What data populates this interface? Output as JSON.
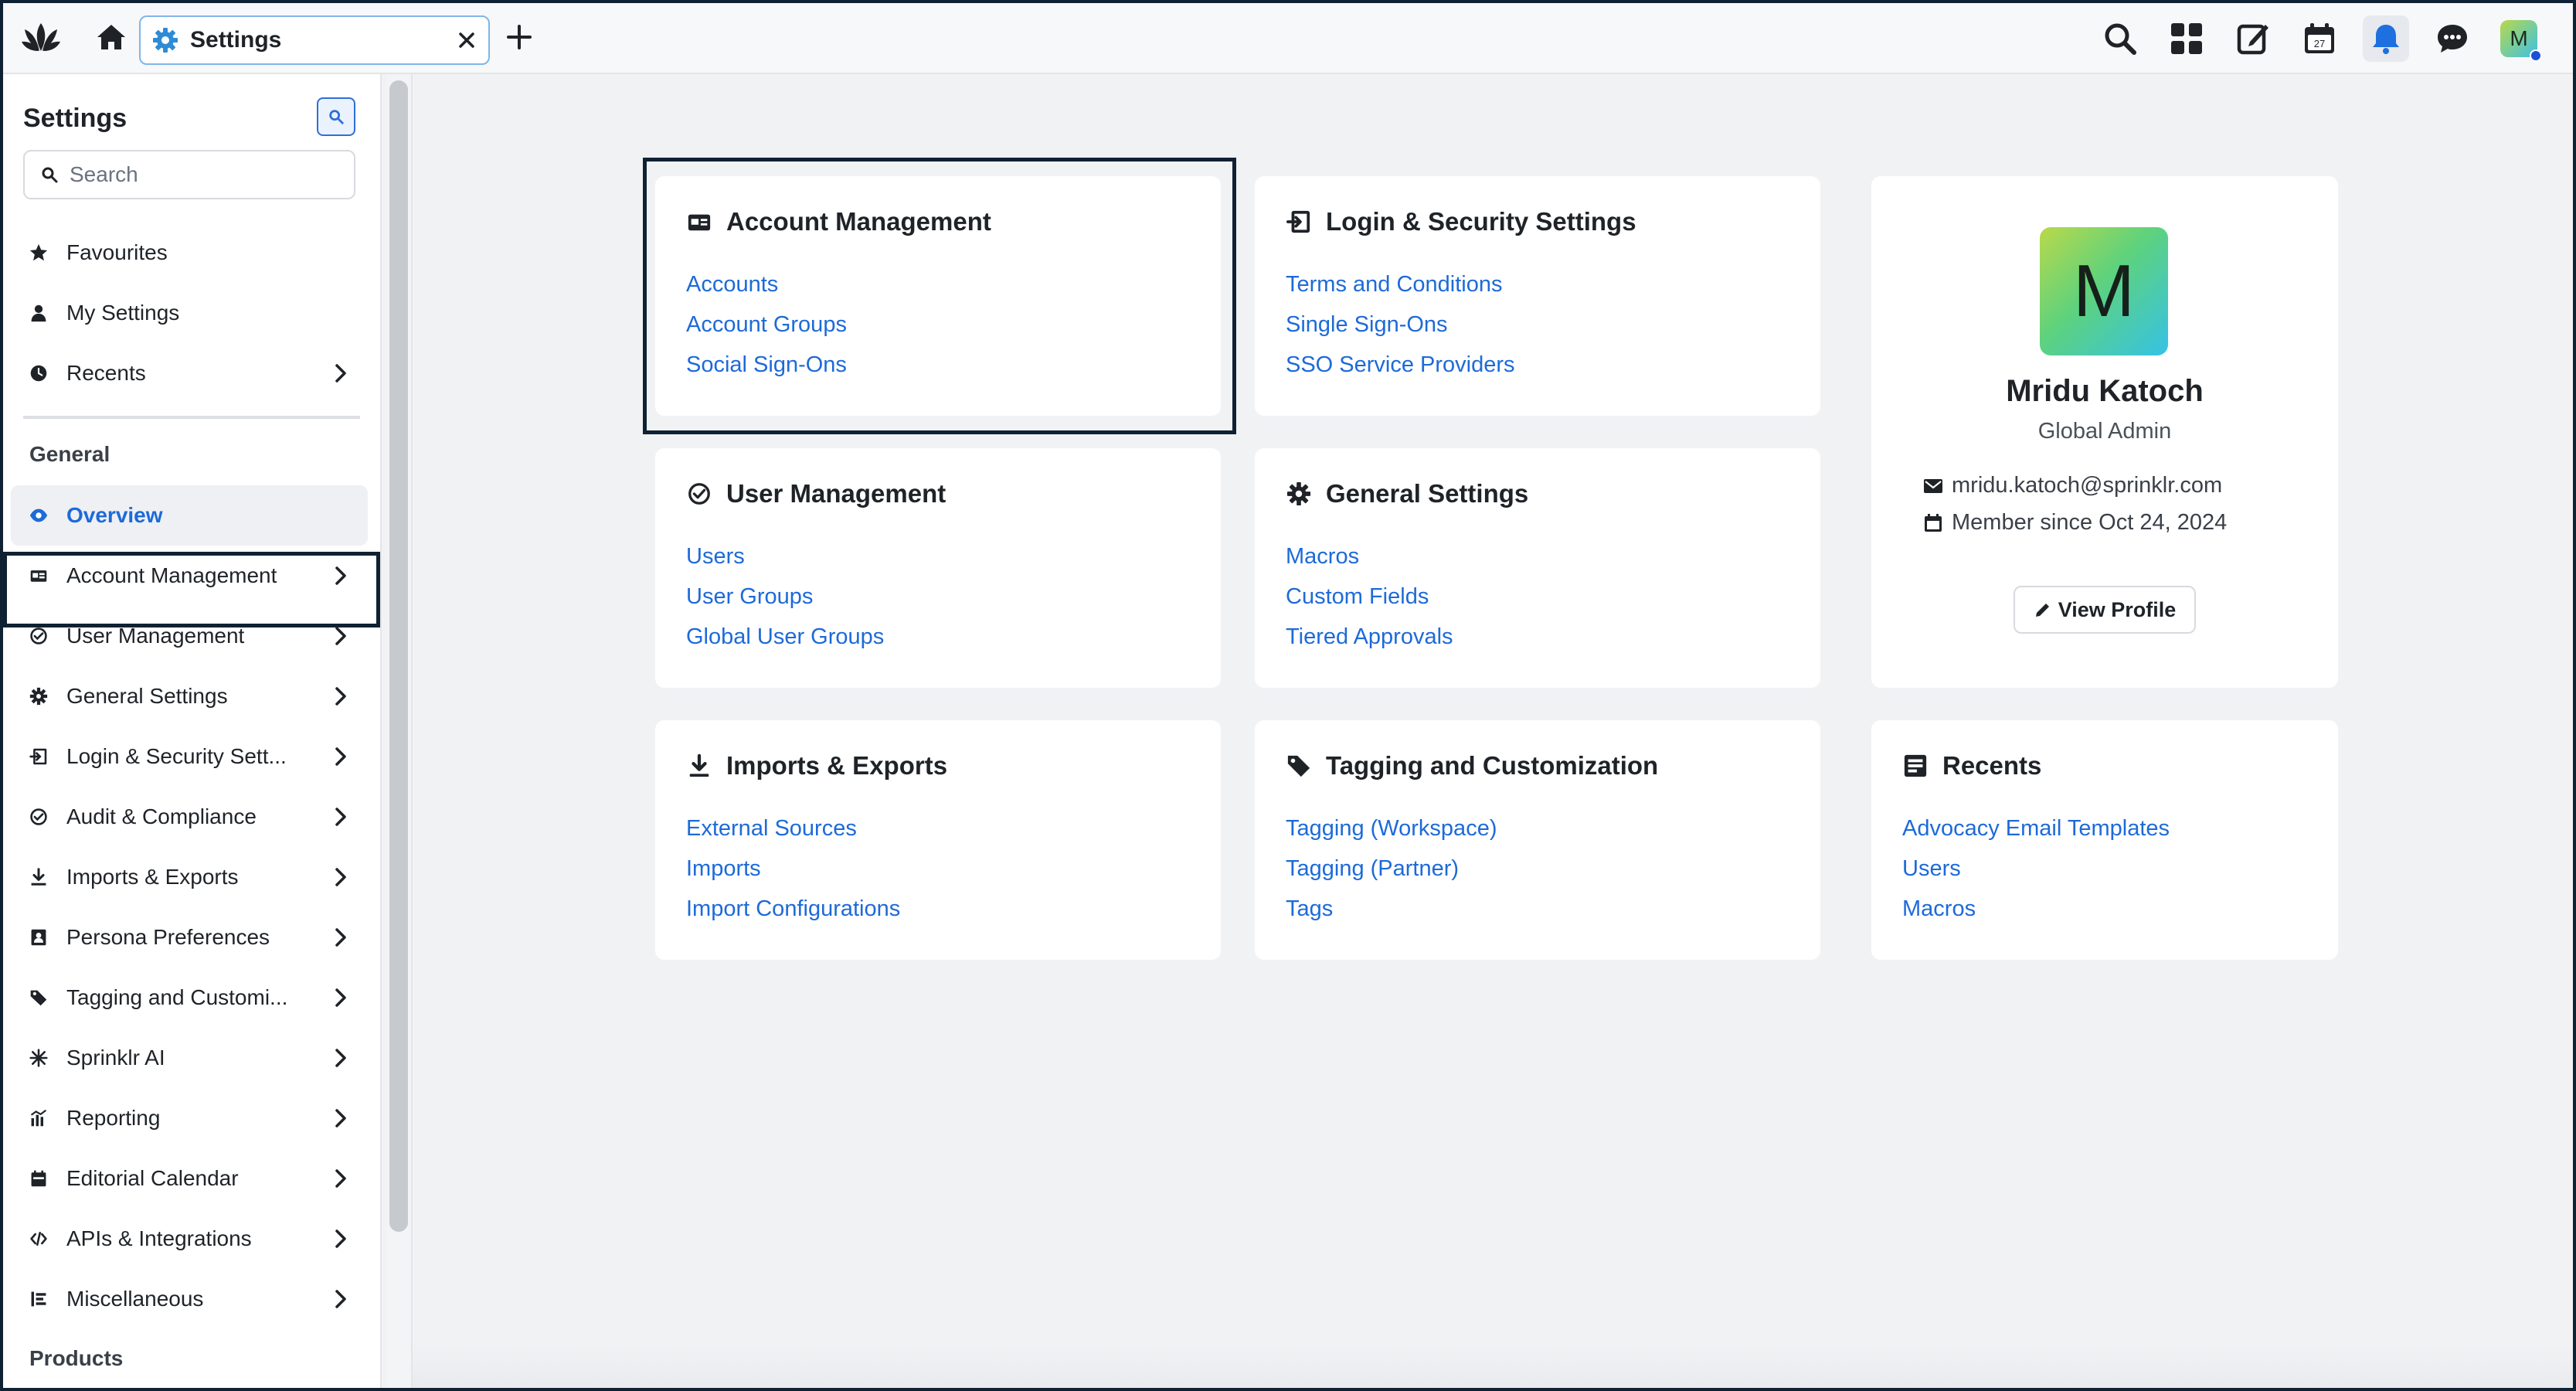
{
  "topbar": {
    "tab_label": "Settings",
    "avatar_initial": "M"
  },
  "sidebar": {
    "title": "Settings",
    "search_placeholder": "Search",
    "quick": [
      {
        "label": "Favourites",
        "icon": "star-icon"
      },
      {
        "label": "My Settings",
        "icon": "person-icon"
      },
      {
        "label": "Recents",
        "icon": "clock-icon"
      }
    ],
    "section_general": "General",
    "overview": "Overview",
    "items": [
      {
        "label": "Account Management",
        "icon": "account-card-icon"
      },
      {
        "label": "User Management",
        "icon": "check-circle-icon"
      },
      {
        "label": "General Settings",
        "icon": "gear-icon"
      },
      {
        "label": "Login & Security Sett...",
        "icon": "login-icon"
      },
      {
        "label": "Audit & Compliance",
        "icon": "audit-icon"
      },
      {
        "label": "Imports & Exports",
        "icon": "download-icon"
      },
      {
        "label": "Persona Preferences",
        "icon": "persona-icon"
      },
      {
        "label": "Tagging and Customi...",
        "icon": "tag-icon"
      },
      {
        "label": "Sprinklr AI",
        "icon": "ai-spark-icon"
      },
      {
        "label": "Reporting",
        "icon": "chart-icon"
      },
      {
        "label": "Editorial Calendar",
        "icon": "calendar-icon"
      },
      {
        "label": "APIs & Integrations",
        "icon": "code-icon"
      },
      {
        "label": "Miscellaneous",
        "icon": "list-icon"
      }
    ],
    "section_products": "Products"
  },
  "cards": {
    "account": {
      "title": "Account Management",
      "links": [
        "Accounts",
        "Account Groups",
        "Social Sign-Ons"
      ]
    },
    "login": {
      "title": "Login & Security Settings",
      "links": [
        "Terms and Conditions",
        "Single Sign-Ons",
        "SSO Service Providers"
      ]
    },
    "user": {
      "title": "User Management",
      "links": [
        "Users",
        "User Groups",
        "Global User Groups"
      ]
    },
    "general": {
      "title": "General Settings",
      "links": [
        "Macros",
        "Custom Fields",
        "Tiered Approvals"
      ]
    },
    "imports": {
      "title": "Imports & Exports",
      "links": [
        "External Sources",
        "Imports",
        "Import Configurations"
      ]
    },
    "tagging": {
      "title": "Tagging and Customization",
      "links": [
        "Tagging (Workspace)",
        "Tagging (Partner)",
        "Tags"
      ]
    },
    "recents": {
      "title": "Recents",
      "links": [
        "Advocacy Email Templates",
        "Users",
        "Macros"
      ]
    }
  },
  "profile": {
    "initial": "M",
    "name": "Mridu Katoch",
    "role": "Global Admin",
    "email": "mridu.katoch@sprinklr.com",
    "member_since": "Member since Oct 24, 2024",
    "button": "View Profile"
  },
  "colors": {
    "accent": "#1d6ad8",
    "highlight_border": "#0f2233",
    "background": "#f1f2f4"
  }
}
